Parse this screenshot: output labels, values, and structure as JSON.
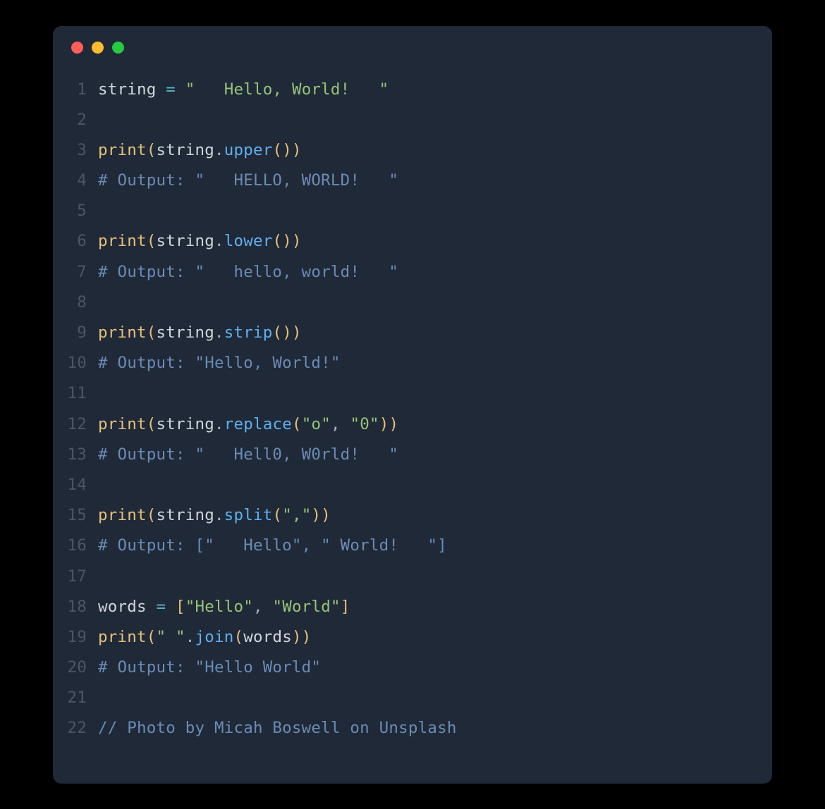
{
  "window": {
    "dots": [
      "red",
      "yellow",
      "green"
    ]
  },
  "colors": {
    "bg": "#1f2937",
    "gutter": "#4b5563",
    "default": "#d1d5db",
    "func": "#e5c07b",
    "attr": "#61afef",
    "string": "#98c379",
    "op": "#56b6c2",
    "comment_blue": "#6b8bb5",
    "dot_red": "#ff5f56",
    "dot_yellow": "#ffbd2e",
    "dot_green": "#27c93f"
  },
  "code": {
    "lines": [
      {
        "n": 1,
        "tokens": [
          {
            "t": "string",
            "c": "ident"
          },
          {
            "t": " ",
            "c": "default"
          },
          {
            "t": "=",
            "c": "op"
          },
          {
            "t": " ",
            "c": "default"
          },
          {
            "t": "\"   Hello, World!   \"",
            "c": "string"
          }
        ]
      },
      {
        "n": 2,
        "tokens": []
      },
      {
        "n": 3,
        "tokens": [
          {
            "t": "print",
            "c": "func"
          },
          {
            "t": "(",
            "c": "brace"
          },
          {
            "t": "string",
            "c": "ident"
          },
          {
            "t": ".",
            "c": "punct-dim"
          },
          {
            "t": "upper",
            "c": "attr"
          },
          {
            "t": "(",
            "c": "brace"
          },
          {
            "t": ")",
            "c": "brace"
          },
          {
            "t": ")",
            "c": "brace"
          }
        ]
      },
      {
        "n": 4,
        "tokens": [
          {
            "t": "# Output: \"   HELLO, WORLD!   \"",
            "c": "comment-blue"
          }
        ]
      },
      {
        "n": 5,
        "tokens": []
      },
      {
        "n": 6,
        "tokens": [
          {
            "t": "print",
            "c": "func"
          },
          {
            "t": "(",
            "c": "brace"
          },
          {
            "t": "string",
            "c": "ident"
          },
          {
            "t": ".",
            "c": "punct-dim"
          },
          {
            "t": "lower",
            "c": "attr"
          },
          {
            "t": "(",
            "c": "brace"
          },
          {
            "t": ")",
            "c": "brace"
          },
          {
            "t": ")",
            "c": "brace"
          }
        ]
      },
      {
        "n": 7,
        "tokens": [
          {
            "t": "# Output: \"   hello, world!   \"",
            "c": "comment-blue"
          }
        ]
      },
      {
        "n": 8,
        "tokens": []
      },
      {
        "n": 9,
        "tokens": [
          {
            "t": "print",
            "c": "func"
          },
          {
            "t": "(",
            "c": "brace"
          },
          {
            "t": "string",
            "c": "ident"
          },
          {
            "t": ".",
            "c": "punct-dim"
          },
          {
            "t": "strip",
            "c": "attr"
          },
          {
            "t": "(",
            "c": "brace"
          },
          {
            "t": ")",
            "c": "brace"
          },
          {
            "t": ")",
            "c": "brace"
          }
        ]
      },
      {
        "n": 10,
        "tokens": [
          {
            "t": "# Output: \"Hello, World!\"",
            "c": "comment-blue"
          }
        ]
      },
      {
        "n": 11,
        "tokens": []
      },
      {
        "n": 12,
        "tokens": [
          {
            "t": "print",
            "c": "func"
          },
          {
            "t": "(",
            "c": "brace"
          },
          {
            "t": "string",
            "c": "ident"
          },
          {
            "t": ".",
            "c": "punct-dim"
          },
          {
            "t": "replace",
            "c": "attr"
          },
          {
            "t": "(",
            "c": "brace"
          },
          {
            "t": "\"o\"",
            "c": "string"
          },
          {
            "t": ",",
            "c": "punct-dim"
          },
          {
            "t": " ",
            "c": "default"
          },
          {
            "t": "\"0\"",
            "c": "string"
          },
          {
            "t": ")",
            "c": "brace"
          },
          {
            "t": ")",
            "c": "brace"
          }
        ]
      },
      {
        "n": 13,
        "tokens": [
          {
            "t": "# Output: \"   Hell0, W0rld!   \"",
            "c": "comment-blue"
          }
        ]
      },
      {
        "n": 14,
        "tokens": []
      },
      {
        "n": 15,
        "tokens": [
          {
            "t": "print",
            "c": "func"
          },
          {
            "t": "(",
            "c": "brace"
          },
          {
            "t": "string",
            "c": "ident"
          },
          {
            "t": ".",
            "c": "punct-dim"
          },
          {
            "t": "split",
            "c": "attr"
          },
          {
            "t": "(",
            "c": "brace"
          },
          {
            "t": "\",\"",
            "c": "string"
          },
          {
            "t": ")",
            "c": "brace"
          },
          {
            "t": ")",
            "c": "brace"
          }
        ]
      },
      {
        "n": 16,
        "tokens": [
          {
            "t": "# Output: [\"   Hello\", \" World!   \"]",
            "c": "comment-blue"
          }
        ]
      },
      {
        "n": 17,
        "tokens": []
      },
      {
        "n": 18,
        "tokens": [
          {
            "t": "words",
            "c": "ident"
          },
          {
            "t": " ",
            "c": "default"
          },
          {
            "t": "=",
            "c": "op"
          },
          {
            "t": " ",
            "c": "default"
          },
          {
            "t": "[",
            "c": "brace"
          },
          {
            "t": "\"Hello\"",
            "c": "string"
          },
          {
            "t": ",",
            "c": "punct-dim"
          },
          {
            "t": " ",
            "c": "default"
          },
          {
            "t": "\"World\"",
            "c": "string"
          },
          {
            "t": "]",
            "c": "brace"
          }
        ]
      },
      {
        "n": 19,
        "tokens": [
          {
            "t": "print",
            "c": "func"
          },
          {
            "t": "(",
            "c": "brace"
          },
          {
            "t": "\" \"",
            "c": "string"
          },
          {
            "t": ".",
            "c": "punct-dim"
          },
          {
            "t": "join",
            "c": "attr"
          },
          {
            "t": "(",
            "c": "brace"
          },
          {
            "t": "words",
            "c": "ident"
          },
          {
            "t": ")",
            "c": "brace"
          },
          {
            "t": ")",
            "c": "brace"
          }
        ]
      },
      {
        "n": 20,
        "tokens": [
          {
            "t": "# Output: \"Hello World\"",
            "c": "comment-blue"
          }
        ]
      },
      {
        "n": 21,
        "tokens": []
      },
      {
        "n": 22,
        "tokens": [
          {
            "t": "// Photo by Micah Boswell on Unsplash",
            "c": "comment-blue"
          }
        ]
      }
    ]
  }
}
